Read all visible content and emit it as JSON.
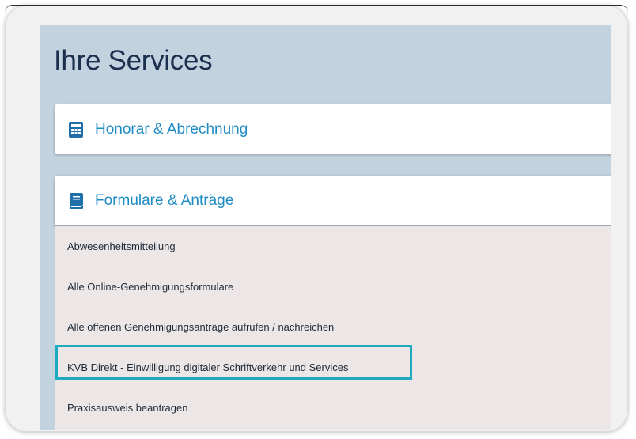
{
  "page": {
    "title": "Ihre Services"
  },
  "sections": [
    {
      "title": "Honorar & Abrechnung",
      "icon": "calculator-icon"
    },
    {
      "title": "Formulare & Anträge",
      "icon": "book-icon",
      "items": [
        "Abwesenheitsmitteilung",
        "Alle Online-Genehmigungsformulare",
        "Alle offenen Genehmigungsanträge aufrufen / nachreichen",
        "KVB Direkt - Einwilligung digitaler Schriftverkehr und Services",
        "Praxisausweis beantragen"
      ]
    }
  ],
  "highlighted_item": "KVB Direkt - Einwilligung digitaler Schriftverkehr und Services",
  "colors": {
    "page_background": "#c3d2df",
    "title": "#1b2f4e",
    "accent": "#1f8bc4",
    "list_background": "#ece7e6",
    "highlight_border": "#1eaabf"
  }
}
